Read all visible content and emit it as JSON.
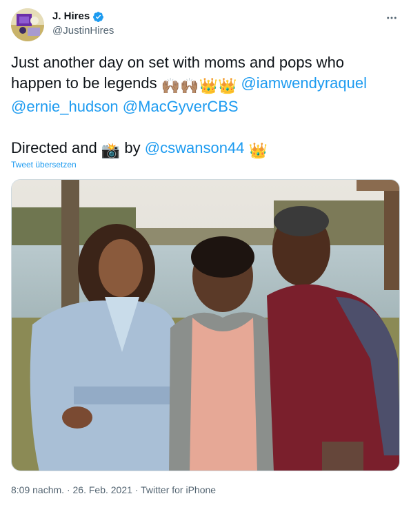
{
  "author": {
    "display_name": "J. Hires",
    "handle": "@JustinHires",
    "verified": true,
    "avatar_icon": "avatar-image"
  },
  "more_icon": "more-dots-icon",
  "tweet": {
    "line1": "Just another day on set with moms and pops who",
    "line2_text": "happen to be legends",
    "line2_emojis": "🙌🏽🙌🏽👑👑",
    "mention1": "@iamwendyraquel",
    "mention2": "@ernie_hudson",
    "mention3": "@MacGyverCBS",
    "line4_text1": "Directed and",
    "line4_emoji_camera": "📸",
    "line4_text2": "by",
    "mention4": "@cswanson44",
    "line4_emoji_crown": "👑"
  },
  "translate_label": "Tweet übersetzen",
  "media": {
    "description_icon": "photo-image"
  },
  "meta": {
    "time": "8:09 nachm.",
    "separator": "·",
    "date": "26. Feb. 2021",
    "source": "Twitter for iPhone"
  },
  "colors": {
    "link": "#1d9bf0",
    "secondary_text": "#536471",
    "primary_text": "#0f1419"
  }
}
